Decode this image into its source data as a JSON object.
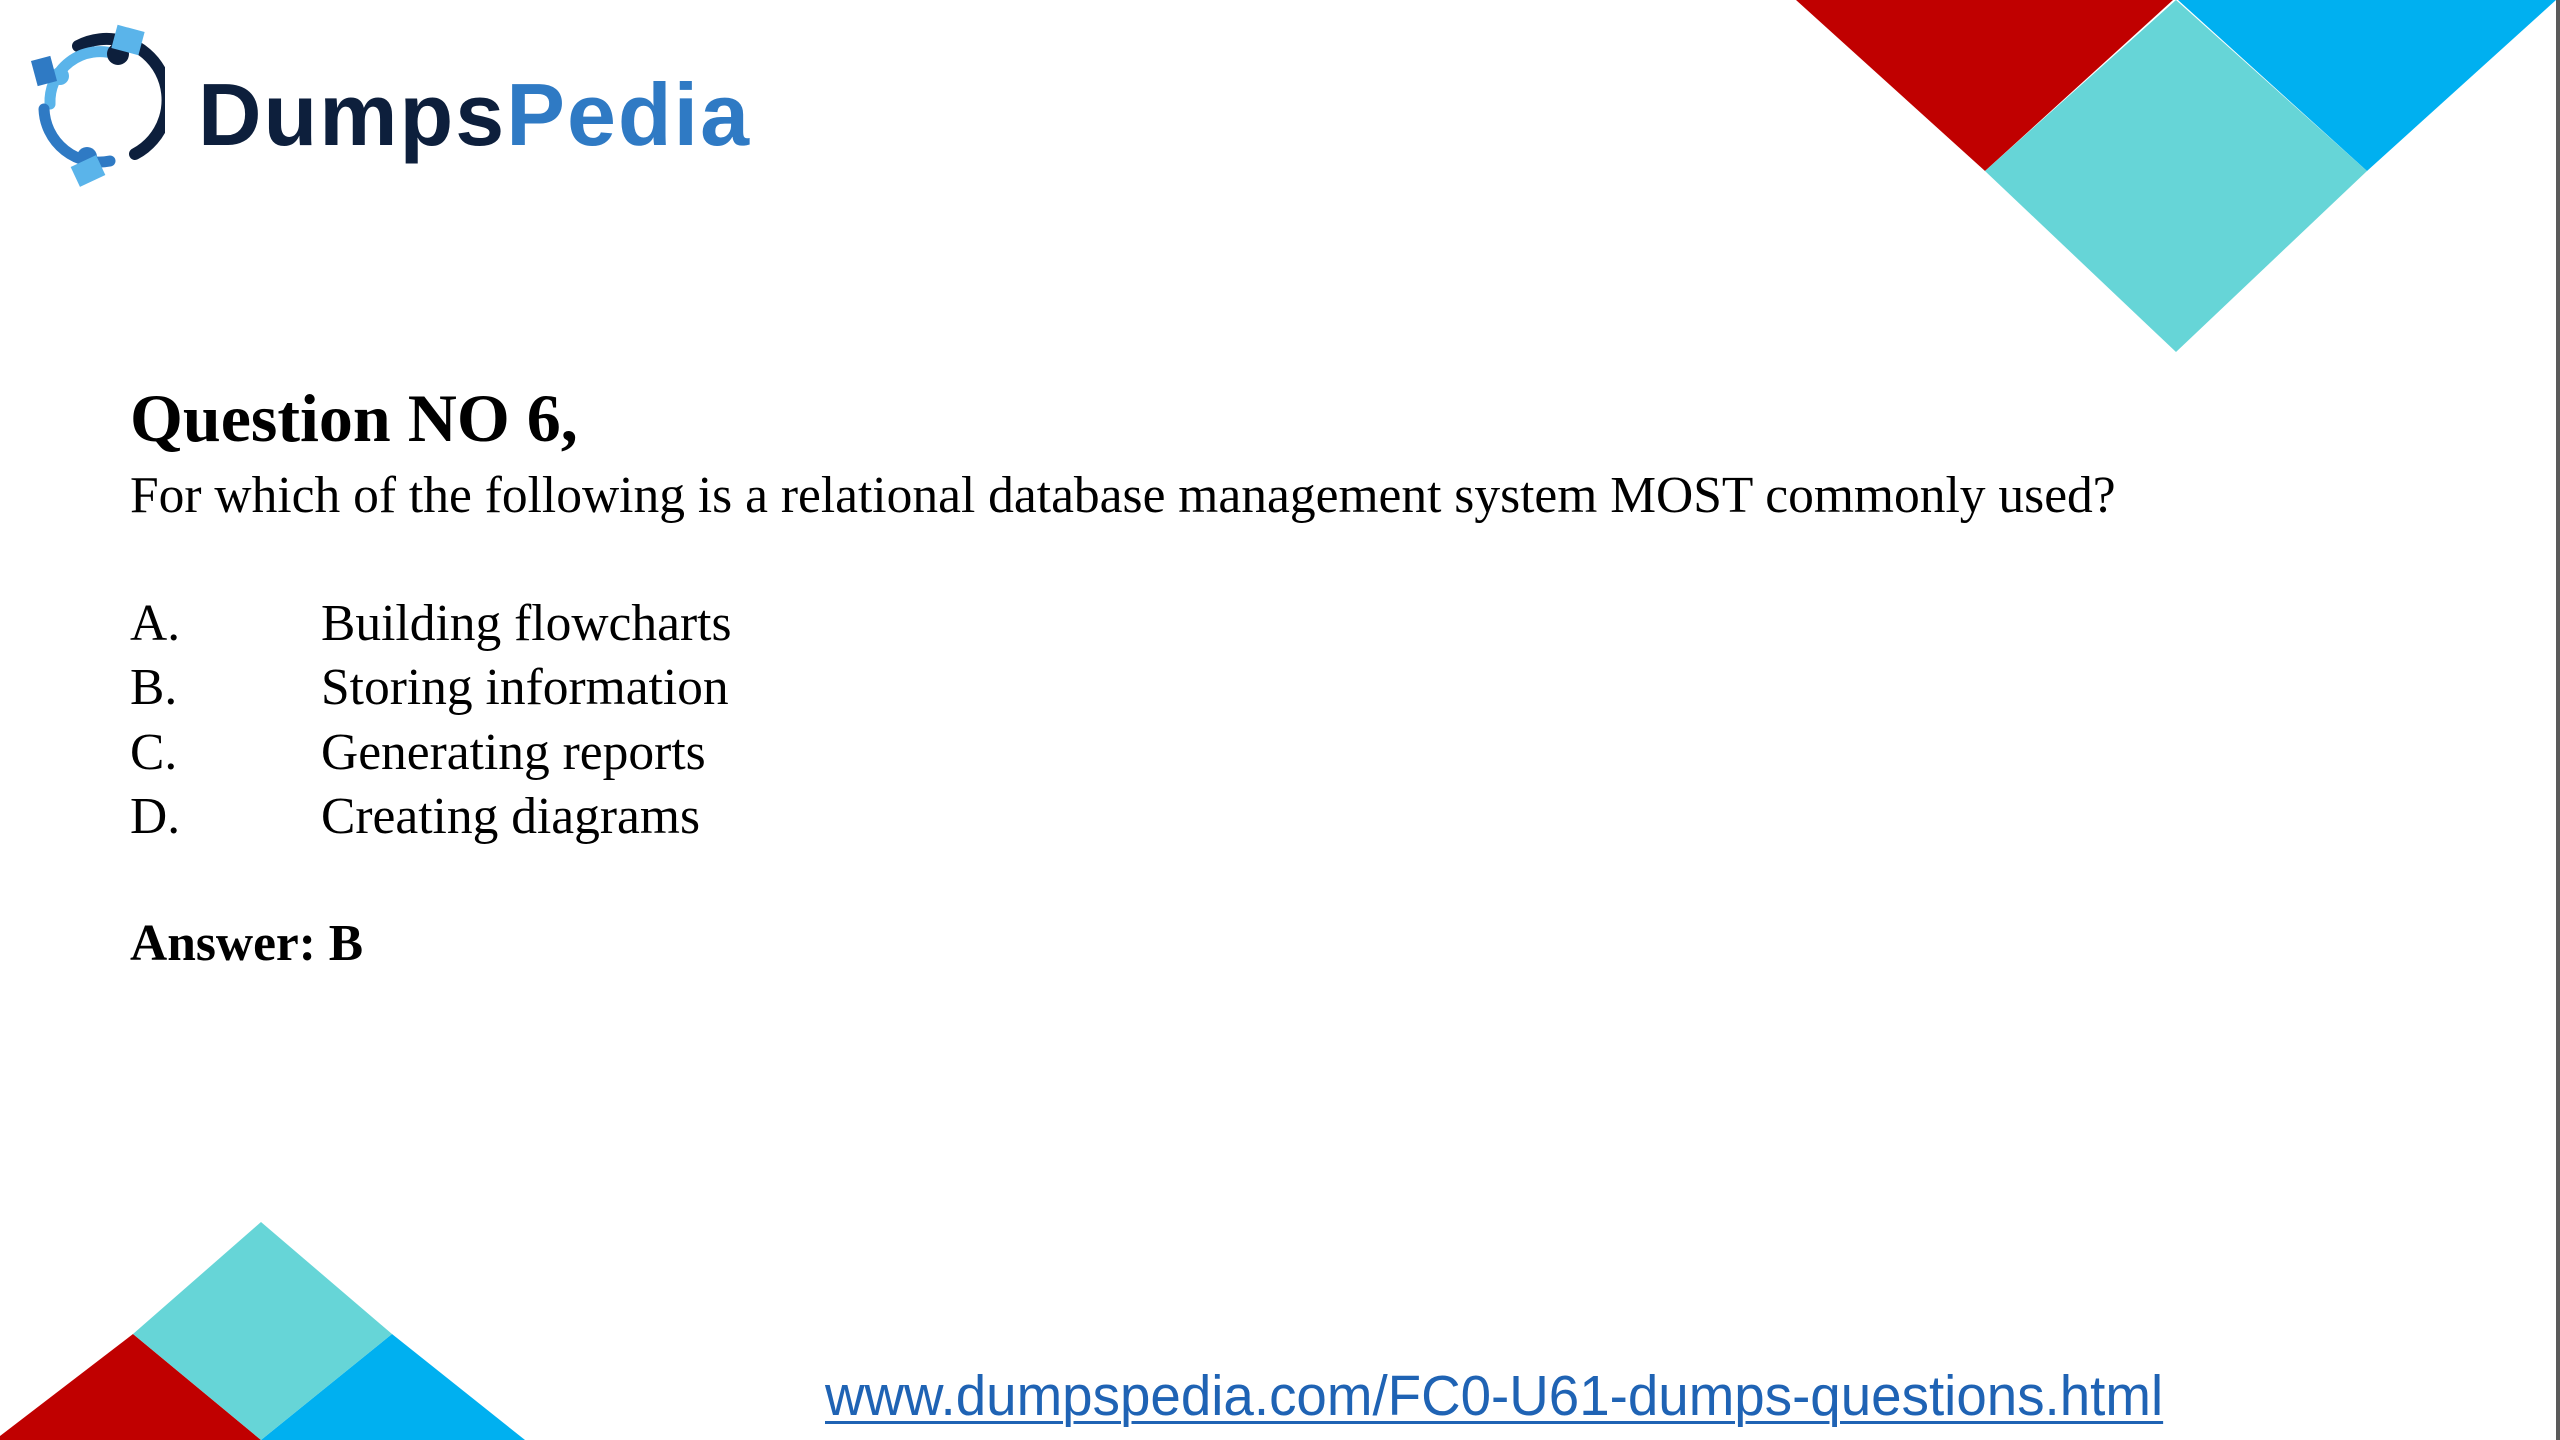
{
  "brand": {
    "name_part1": "Dumps",
    "name_part2": "Pedia",
    "colors": {
      "dark": "#0d1f3c",
      "blue": "#2f7ac4",
      "light_blue": "#5ab4ea"
    }
  },
  "decorations": {
    "colors": {
      "red": "#c00000",
      "cyan": "#66d5d7",
      "blue": "#00b0f0"
    }
  },
  "question": {
    "title": "Question NO 6,",
    "text": "For which of the following is a relational database management system MOST commonly used?",
    "options": [
      {
        "letter": "A.",
        "text": "Building flowcharts"
      },
      {
        "letter": "B.",
        "text": "Storing information"
      },
      {
        "letter": "C.",
        "text": "Generating reports"
      },
      {
        "letter": "D.",
        "text": "Creating diagrams"
      }
    ],
    "answer": "Answer: B"
  },
  "footer": {
    "url": "www.dumpspedia.com/FC0-U61-dumps-questions.html",
    "url_color": "#1f63b4"
  }
}
